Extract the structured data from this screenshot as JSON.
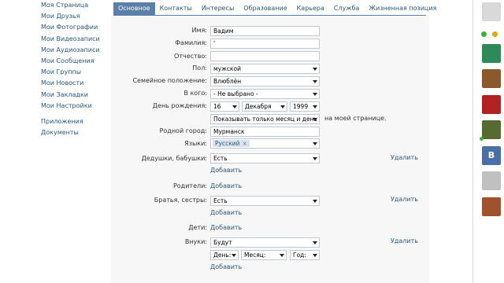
{
  "nav": {
    "items": [
      "Моя Страница",
      "Мои Друзья",
      "Мои Фотографии",
      "Мои Видеозаписи",
      "Мои Аудиозаписи",
      "Мои Сообщения",
      "Мои Группы",
      "Мои Новости",
      "Мои Закладки",
      "Мои Настройки"
    ],
    "extra": [
      "Приложения",
      "Документы"
    ]
  },
  "tabs": [
    "Основное",
    "Контакты",
    "Интересы",
    "Образование",
    "Карьера",
    "Служба",
    "Жизненная позиция"
  ],
  "form": {
    "name_label": "Имя:",
    "name_value": "Вадим",
    "surname_label": "Фамилия:",
    "surname_value": "'",
    "patronymic_label": "Отчество:",
    "patronymic_value": "",
    "sex_label": "Пол:",
    "sex_value": "мужской",
    "marital_label": "Семейное положение:",
    "marital_value": "Влюблён",
    "partner_label": "В кого:",
    "partner_value": "- Не выбрано -",
    "birthday_label": "День рождения:",
    "bday_day": "16",
    "bday_month": "Декабря",
    "bday_year": "1999",
    "birthday_show_value": "Показывать только месяц и день",
    "birthday_show_suffix": "на моей странице.",
    "hometown_label": "Родной город:",
    "hometown_value": "Мурманск",
    "languages_label": "Языки:",
    "language_tag": "Русский",
    "tag_remove": "×",
    "grandparents_label": "Дедушки, бабушки:",
    "grandparents_value": "Есть",
    "parents_label": "Родители:",
    "siblings_label": "Братья, сестры:",
    "siblings_value": "Есть",
    "children_label": "Дети:",
    "grandchildren_label": "Внуки:",
    "grandchildren_value": "Будут",
    "day_placeholder": "День:",
    "month_placeholder": "Месяц:",
    "year_placeholder": "Год:",
    "add_link": "Добавить",
    "delete_link": "Удалить"
  },
  "right_panel": {
    "vk_badge": "В",
    "colors": [
      "#2e8b57",
      "#8b5a2b",
      "#b22222",
      "#556b2f",
      "#4a6fa5",
      "#8b4513",
      "#5b7fa6",
      "#c0c0c0",
      "#a0522d"
    ]
  }
}
